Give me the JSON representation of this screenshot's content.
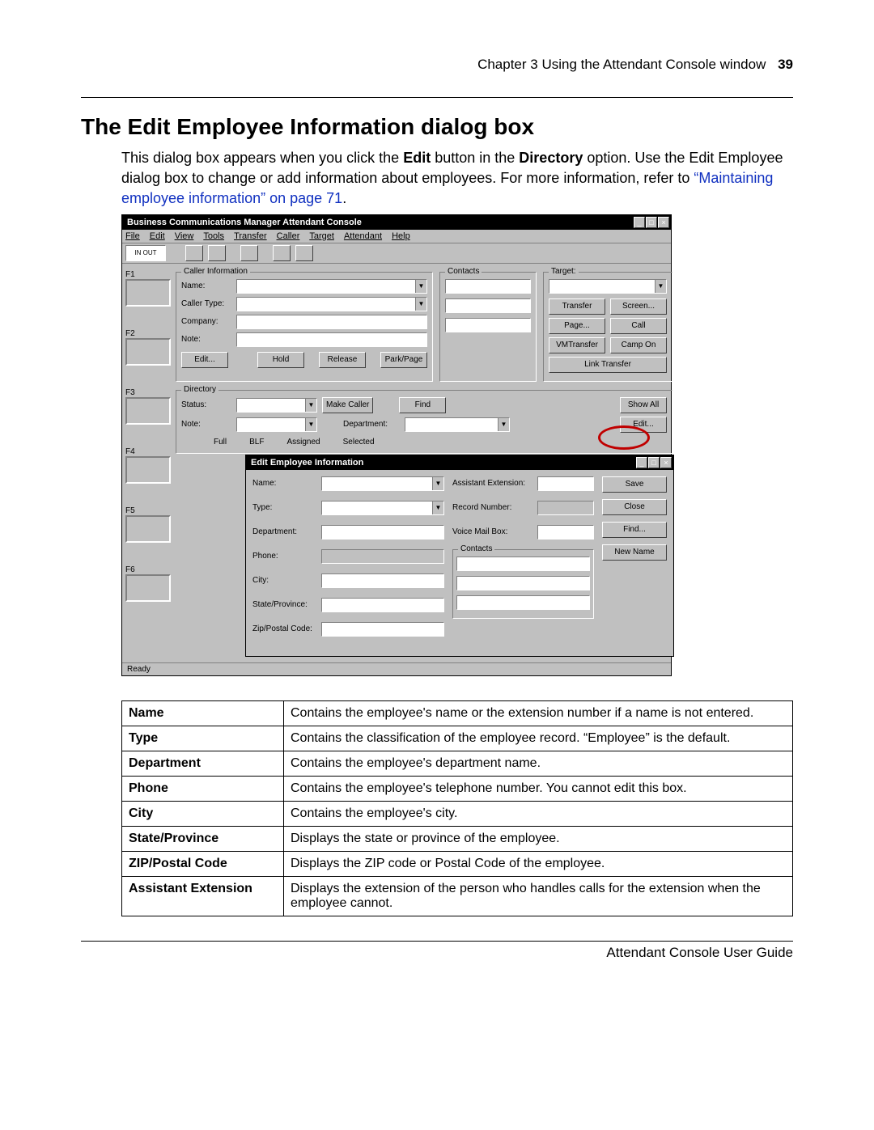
{
  "header": {
    "chapter_line": "Chapter 3  Using the Attendant Console window",
    "page_number": "39"
  },
  "section": {
    "title": "The Edit Employee Information dialog box"
  },
  "para": {
    "t1": "This dialog box appears when you click the ",
    "b1": "Edit",
    "t2": " button in the ",
    "b2": "Directory",
    "t3": " option. Use the Edit Employee dialog box to change or add information about employees. For more information, refer to ",
    "xref": "“Maintaining employee information” on page 71",
    "t4": "."
  },
  "shot": {
    "main_title": "Business Communications Manager Attendant Console",
    "menu": [
      "File",
      "Edit",
      "View",
      "Tools",
      "Transfer",
      "Caller",
      "Target",
      "Attendant",
      "Help"
    ],
    "inout": "IN   OUT",
    "loops": [
      "F1",
      "F2",
      "F3",
      "F4",
      "F5",
      "F6"
    ],
    "caller_info": {
      "legend": "Caller Information",
      "name": "Name:",
      "caller_type": "Caller Type:",
      "company": "Company:",
      "note": "Note:",
      "edit_btn": "Edit...",
      "hold_btn": "Hold",
      "release_btn": "Release",
      "parkpage_btn": "Park/Page"
    },
    "contacts_legend": "Contacts",
    "target": {
      "legend": "Target:",
      "transfer": "Transfer",
      "screen": "Screen...",
      "page": "Page...",
      "call": "Call",
      "vmtransfer": "VMTransfer",
      "campon": "Camp On",
      "linktransfer": "Link Transfer"
    },
    "directory": {
      "legend": "Directory",
      "status": "Status:",
      "note": "Note:",
      "make_caller": "Make Caller",
      "find": "Find",
      "show_all": "Show All",
      "department": "Department:",
      "edit": "Edit...",
      "tabs": [
        "Full",
        "BLF",
        "Assigned",
        "Selected"
      ]
    },
    "status_text": "Ready",
    "sub": {
      "title": "Edit Employee Information",
      "name": "Name:",
      "type": "Type:",
      "department": "Department:",
      "phone": "Phone:",
      "city": "City:",
      "state": "State/Province:",
      "zip": "Zip/Postal Code:",
      "assistant": "Assistant Extension:",
      "record": "Record Number:",
      "vmail": "Voice Mail Box:",
      "contacts_legend": "Contacts",
      "save": "Save",
      "close": "Close",
      "find": "Find...",
      "newname": "New Name"
    }
  },
  "table": [
    {
      "k": "Name",
      "v": "Contains the employee's name or the extension number if a name is not entered."
    },
    {
      "k": "Type",
      "v": "Contains the classification of the employee record. “Employee” is the default."
    },
    {
      "k": "Department",
      "v": "Contains the employee's department name."
    },
    {
      "k": "Phone",
      "v": "Contains the employee's telephone number. You cannot edit this box."
    },
    {
      "k": "City",
      "v": "Contains the employee's city."
    },
    {
      "k": "State/Province",
      "v": "Displays the state or province of the employee."
    },
    {
      "k": "ZIP/Postal Code",
      "v": "Displays the ZIP code or Postal Code of the employee."
    },
    {
      "k": "Assistant Extension",
      "v": "Displays the extension of the person who handles calls for the extension when the employee cannot."
    }
  ],
  "footer": {
    "text": "Attendant Console User Guide"
  }
}
